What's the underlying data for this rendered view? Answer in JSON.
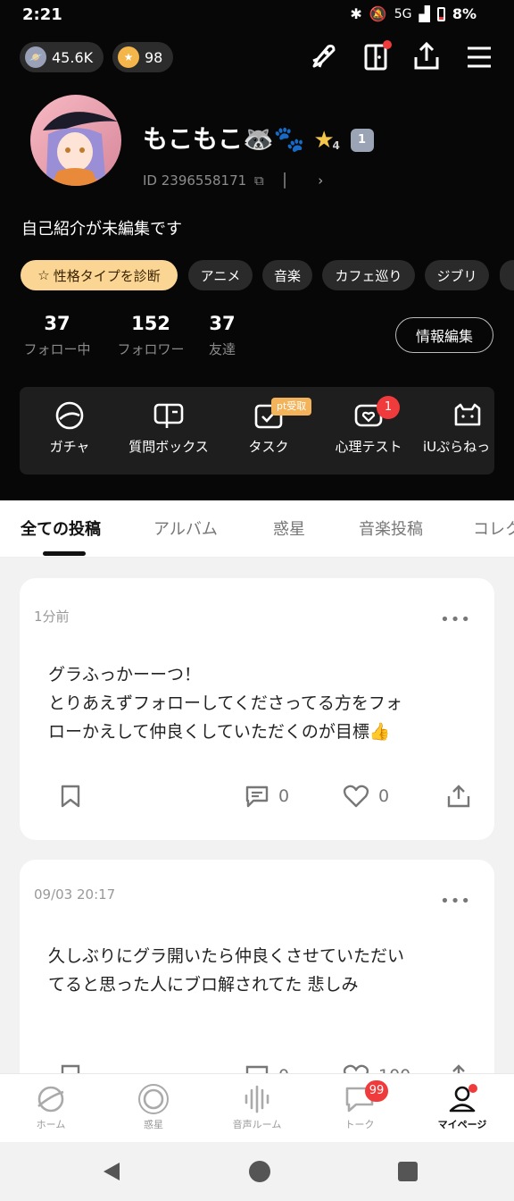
{
  "status_bar": {
    "time": "2:21",
    "network": "5G",
    "battery": "8%"
  },
  "currency": {
    "star_points": "45.6K",
    "coins": "98"
  },
  "profile": {
    "name": "もこもこ🦝🐾",
    "level": "4",
    "rank_badge": "1",
    "id_text": "ID 2396558171",
    "bio": "自己紹介が未編集です"
  },
  "tags": [
    "性格タイプを診断",
    "アニメ",
    "音楽",
    "カフェ巡り",
    "ジブリ"
  ],
  "stats": [
    {
      "value": "37",
      "label": "フォロー中"
    },
    {
      "value": "152",
      "label": "フォロワー"
    },
    {
      "value": "37",
      "label": "友達"
    }
  ],
  "edit_button": "情報編集",
  "features": [
    {
      "label": "ガチャ",
      "icon": "gacha-icon"
    },
    {
      "label": "質問ボックス",
      "icon": "question-box-icon"
    },
    {
      "label": "タスク",
      "icon": "task-icon",
      "badge": "pt受取"
    },
    {
      "label": "心理テスト",
      "icon": "psych-test-icon",
      "badge": "1"
    },
    {
      "label": "iUぷらねっ",
      "icon": "cat-icon"
    }
  ],
  "tabs": [
    "全ての投稿",
    "アルバム",
    "惑星",
    "音楽投稿",
    "コレク"
  ],
  "posts": [
    {
      "time": "1分前",
      "lines": [
        "グラふっかーーつ！",
        "とりあえずフォローしてくださってる方をフォ",
        "ローかえして仲良くしていただくのが目標👍"
      ],
      "comments": "0",
      "likes": "0"
    },
    {
      "time": "09/03 20:17",
      "lines": [
        "久しぶりにグラ開いたら仲良くさせていただい",
        "てると思った人にブロ解されてた 悲しみ"
      ],
      "comments": "0",
      "likes": "100"
    }
  ],
  "bottom_nav": [
    {
      "label": "ホーム",
      "icon": "planet-home-icon"
    },
    {
      "label": "惑星",
      "icon": "planet-ring-icon"
    },
    {
      "label": "音声ルーム",
      "icon": "voice-wave-icon"
    },
    {
      "label": "トーク",
      "icon": "chat-icon",
      "badge": "99"
    },
    {
      "label": "マイページ",
      "icon": "person-icon"
    }
  ],
  "colors": {
    "accent_red": "#ef3b3b",
    "tag_highlight": "#fbd594",
    "dark_bg": "#070707"
  }
}
